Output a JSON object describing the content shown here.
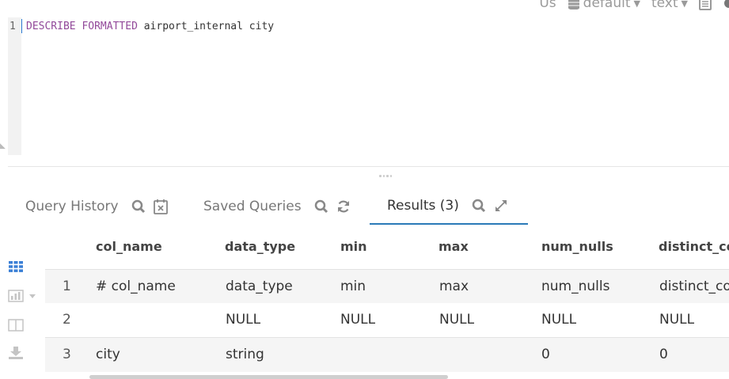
{
  "toolbar": {
    "us_text": "Us",
    "database": "default",
    "format": "text"
  },
  "editor": {
    "line_number": "1",
    "tokens": [
      "DESCRIBE",
      "FORMATTED",
      "airport_internal city"
    ]
  },
  "tabs": [
    {
      "label": "Query History",
      "icons": [
        "search-icon",
        "calendar-clear-icon"
      ]
    },
    {
      "label": "Saved Queries",
      "icons": [
        "search-icon",
        "refresh-icon"
      ]
    },
    {
      "label": "Results (3)",
      "icons": [
        "search-icon",
        "expand-icon"
      ],
      "active": true
    }
  ],
  "grid": {
    "headers": [
      "col_name",
      "data_type",
      "min",
      "max",
      "num_nulls",
      "distinct_co"
    ],
    "rows": [
      {
        "num": "1",
        "cells": [
          "# col_name",
          "data_type",
          "min",
          "max",
          "num_nulls",
          "distinct_cou"
        ]
      },
      {
        "num": "2",
        "cells": [
          "",
          "NULL",
          "NULL",
          "NULL",
          "NULL",
          "NULL"
        ]
      },
      {
        "num": "3",
        "cells": [
          "city",
          "string",
          "",
          "",
          "0",
          "0"
        ]
      }
    ]
  },
  "colors": {
    "keyword": "#92499a",
    "active_tab_underline": "#2b7ab8",
    "grid_icon": "#3a7fd6"
  }
}
